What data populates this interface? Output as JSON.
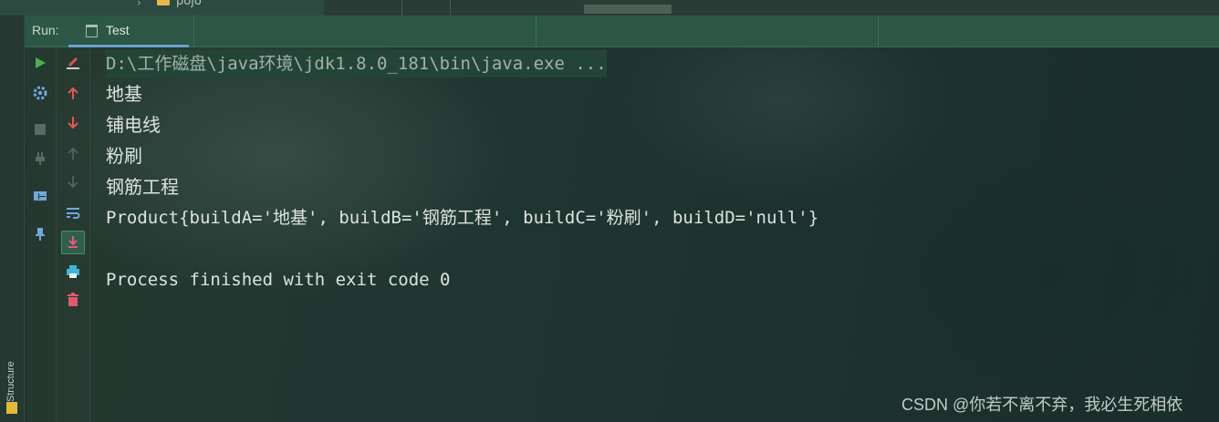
{
  "top": {
    "folder_label": "pojo"
  },
  "side": {
    "structure_label": "Structure"
  },
  "runbar": {
    "label": "Run:",
    "tab_label": "Test"
  },
  "toolbar_left": [
    {
      "name": "rerun-icon",
      "color": "#4caf50"
    },
    {
      "name": "settings-icon",
      "color": "#6fa8dc"
    },
    {
      "name": "stop-icon",
      "color": "#5a6a64"
    },
    {
      "name": "plug-icon",
      "color": "#5a6a64"
    },
    {
      "name": "layout-icon",
      "color": "#6fa8dc"
    },
    {
      "name": "pin-icon",
      "color": "#6fa8dc"
    }
  ],
  "toolbar_right": [
    {
      "name": "edit-config-icon",
      "color": "#d9534f"
    },
    {
      "name": "up-arrow-icon",
      "color": "#e05a50"
    },
    {
      "name": "down-arrow-icon",
      "color": "#e05a50"
    },
    {
      "name": "up-arrow-disabled-icon",
      "color": "#5a6a64"
    },
    {
      "name": "down-arrow-disabled-icon",
      "color": "#5a6a64"
    },
    {
      "name": "soft-wrap-icon",
      "color": "#6fa8dc"
    },
    {
      "name": "scroll-to-end-icon",
      "color": "#e05a8a"
    },
    {
      "name": "print-icon",
      "color": "#3fb6d8"
    },
    {
      "name": "trash-icon",
      "color": "#e05a70"
    }
  ],
  "console": {
    "command": "D:\\工作磁盘\\java环境\\jdk1.8.0_181\\bin\\java.exe ...",
    "lines": [
      "地基",
      "铺电线",
      "粉刷",
      "钢筋工程"
    ],
    "product": "Product{buildA='地基', buildB='钢筋工程', buildC='粉刷', buildD='null'}",
    "exit": "Process finished with exit code 0"
  },
  "watermark": "CSDN @你若不离不弃，我必生死相依"
}
